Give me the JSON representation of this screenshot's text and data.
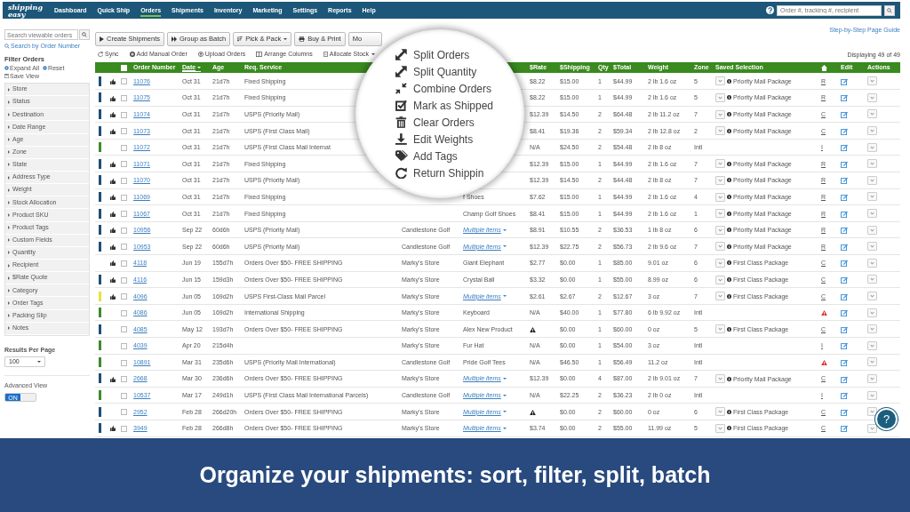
{
  "nav": {
    "logo": "shipping easy",
    "items": [
      {
        "label": "Dashboard",
        "selected": false
      },
      {
        "label": "Quick Ship",
        "selected": false
      },
      {
        "label": "Orders",
        "selected": true
      },
      {
        "label": "Shipments",
        "selected": false
      },
      {
        "label": "Inventory",
        "selected": false
      },
      {
        "label": "Marketing",
        "selected": false
      },
      {
        "label": "Settings",
        "selected": false
      },
      {
        "label": "Reports",
        "selected": false
      },
      {
        "label": "Help",
        "selected": false
      }
    ],
    "search": {
      "placeholder": "Order #, tracking #, recipient"
    }
  },
  "page_guide": "Step-by-Step Page Guide",
  "sidebar": {
    "search": {
      "placeholder": "Search viewable orders"
    },
    "search_link": "Search by Order Number",
    "filter_title": "Filter Orders",
    "filter_actions": [
      "Expand All",
      "Reset",
      "Save View"
    ],
    "filters": [
      "Store",
      "Status",
      "Destination",
      "Date Range",
      "Age",
      "Zone",
      "State",
      "Address Type",
      "Weight",
      "Stock Allocation",
      "Product SKU",
      "Product Tags",
      "Custom Fields",
      "Quantity",
      "Recipient",
      "$Rate Quote",
      "Category",
      "Order Tags",
      "Packing Slip",
      "Notes"
    ],
    "results_label": "Results Per Page",
    "results_value": "100",
    "advanced_label": "Advanced View",
    "advanced_toggle": {
      "label": "ON",
      "on": true
    }
  },
  "toolbar": {
    "buttons": [
      {
        "label": "Create Shipments",
        "dropdown": false
      },
      {
        "label": "Group as Batch",
        "dropdown": false
      },
      {
        "label": "Pick & Pack",
        "dropdown": true
      },
      {
        "label": "Buy & Print",
        "dropdown": false
      },
      {
        "label": "Mo",
        "dropdown": false
      }
    ],
    "actions": [
      {
        "label": "Sync",
        "dropdown": false
      },
      {
        "label": "Add Manual Order",
        "dropdown": false
      },
      {
        "label": "Upload Orders",
        "dropdown": false
      },
      {
        "label": "Arrange Columns",
        "dropdown": false
      },
      {
        "label": "Allocate Stock",
        "dropdown": true
      }
    ]
  },
  "displaying": "Displaying 49 of 49",
  "menu": {
    "items": [
      "Split Orders",
      "Split Quantity",
      "Combine Orders",
      "Mark as Shipped",
      "Clear Orders",
      "Edit Weights",
      "Add Tags",
      "Return Shippin"
    ]
  },
  "table": {
    "select_all": {
      "checked": false
    },
    "columns": [
      {
        "label": "Order Number",
        "sorted": false
      },
      {
        "label": "Date",
        "sorted": true
      },
      {
        "label": "Age",
        "sorted": false
      },
      {
        "label": "Req. Service",
        "sorted": false
      },
      {
        "label": "$Rate",
        "sorted": false
      },
      {
        "label": "$Shipping",
        "sorted": false
      },
      {
        "label": "Qty",
        "sorted": false
      },
      {
        "label": "$Total",
        "sorted": false
      },
      {
        "label": "Weight",
        "sorted": false
      },
      {
        "label": "Zone",
        "sorted": false
      },
      {
        "label": "Saved Selection",
        "sorted": false
      },
      {
        "label": "Edit",
        "sorted": false
      },
      {
        "label": "Actions",
        "sorted": false
      }
    ],
    "rows": [
      {
        "color": "#1d4e78",
        "marked": true,
        "checked": false,
        "order": "11076",
        "date": "Oct 31",
        "age": "21d7h",
        "service": "Fixed Shipping",
        "rate": "$8.22",
        "shipping": "$15.00",
        "qty": "1",
        "total": "$44.99",
        "weight": "2 lb 1.6 oz",
        "zone": "5",
        "selection": "Priority Mail Package",
        "home": "R"
      },
      {
        "color": "#1d4e78",
        "marked": true,
        "checked": false,
        "order": "11075",
        "date": "Oct 31",
        "age": "21d7h",
        "service": "Fixed Shipping",
        "rate": "$8.22",
        "shipping": "$15.00",
        "qty": "1",
        "total": "$44.99",
        "weight": "2 lb 1.6 oz",
        "zone": "5",
        "selection": "Priority Mail Package",
        "home": "R"
      },
      {
        "color": "#1d4e78",
        "marked": true,
        "checked": false,
        "order": "11074",
        "date": "Oct 31",
        "age": "21d7h",
        "service": "USPS (Priority Mail)",
        "rate": "$12.39",
        "shipping": "$14.50",
        "qty": "2",
        "total": "$64.48",
        "weight": "2 lb 11.2 oz",
        "zone": "7",
        "selection": "Priority Mail Package",
        "home": "C"
      },
      {
        "color": "#1d4e78",
        "marked": true,
        "checked": false,
        "order": "11073",
        "date": "Oct 31",
        "age": "21d7h",
        "service": "USPS (First Class Mail)",
        "rate": "$8.41",
        "shipping": "$19.36",
        "qty": "2",
        "total": "$59.34",
        "weight": "2 lb 12.8 oz",
        "zone": "2",
        "selection": "Priority Mail Package",
        "home": "C"
      },
      {
        "color": "#3f8a2c",
        "marked": false,
        "checked": false,
        "order": "11072",
        "date": "Oct 31",
        "age": "21d7h",
        "service": "USPS (First Class Mail Internat",
        "rate": "N/A",
        "shipping": "$24.50",
        "qty": "2",
        "total": "$54.48",
        "weight": "2 lb 8 oz",
        "zone": "Intl",
        "home": "I"
      },
      {
        "color": "#1d4e78",
        "marked": true,
        "checked": false,
        "order": "11071",
        "date": "Oct 31",
        "age": "21d7h",
        "service": "Fixed Shipping",
        "rate": "$12.39",
        "shipping": "$15.00",
        "qty": "1",
        "total": "$44.99",
        "weight": "2 lb 1.6 oz",
        "zone": "7",
        "selection": "Priority Mail Package",
        "home": "R"
      },
      {
        "color": "#1d4e78",
        "marked": true,
        "checked": false,
        "order": "11070",
        "date": "Oct 31",
        "age": "21d7h",
        "service": "USPS (Priority Mail)",
        "rate": "$12.39",
        "shipping": "$14.50",
        "qty": "2",
        "total": "$44.48",
        "weight": "2 lb 8 oz",
        "zone": "7",
        "selection": "Priority Mail Package",
        "home": "R"
      },
      {
        "color": "#1d4e78",
        "marked": true,
        "checked": false,
        "order": "11069",
        "date": "Oct 31",
        "age": "21d7h",
        "service": "Fixed Shipping",
        "item": "f Shoes",
        "item_dropdown": false,
        "rate": "$7.62",
        "shipping": "$15.00",
        "qty": "1",
        "total": "$44.99",
        "weight": "2 lb 1.6 oz",
        "zone": "4",
        "selection": "Priority Mail Package",
        "home": "R"
      },
      {
        "color": "#1d4e78",
        "marked": true,
        "checked": false,
        "order": "11067",
        "date": "Oct 31",
        "age": "21d7h",
        "service": "Fixed Shipping",
        "item": "Champ Golf Shoes",
        "item_dropdown": false,
        "rate": "$8.41",
        "shipping": "$15.00",
        "qty": "1",
        "total": "$44.99",
        "weight": "2 lb 1.6 oz",
        "zone": "1",
        "selection": "Priority Mail Package",
        "home": "R"
      },
      {
        "color": "#1d4e78",
        "marked": true,
        "checked": false,
        "order": "10956",
        "date": "Sep 22",
        "age": "60d6h",
        "service": "USPS (Priority Mail)",
        "store": "Candlestone Golf",
        "item": "Multiple items",
        "item_dropdown": true,
        "rate": "$8.91",
        "shipping": "$10.55",
        "qty": "2",
        "total": "$36.53",
        "weight": "1 lb 8 oz",
        "zone": "6",
        "selection": "Priority Mail Package",
        "home": "R"
      },
      {
        "color": "#1d4e78",
        "marked": true,
        "checked": false,
        "order": "10953",
        "date": "Sep 22",
        "age": "60d6h",
        "service": "USPS (Priority Mail)",
        "store": "Candlestone Golf",
        "item": "Multiple items",
        "item_dropdown": true,
        "rate": "$12.39",
        "shipping": "$22.75",
        "qty": "2",
        "total": "$56.73",
        "weight": "2 lb 9.6 oz",
        "zone": "7",
        "selection": "Priority Mail Package",
        "home": "R"
      },
      {
        "marked": true,
        "checked": false,
        "order": "4118",
        "date": "Jun 19",
        "age": "155d7h",
        "service": "Orders Over $50- FREE SHIPPING",
        "store": "Marky's Store",
        "item": "Giant Elephant",
        "item_dropdown": false,
        "rate": "$2.77",
        "shipping": "$0.00",
        "qty": "1",
        "total": "$85.00",
        "weight": "9.01 oz",
        "zone": "6",
        "selection": "First Class Package",
        "home": "C"
      },
      {
        "color": "#1d4e78",
        "marked": true,
        "checked": false,
        "order": "4116",
        "date": "Jun 15",
        "age": "159d3h",
        "service": "Orders Over $50- FREE SHIPPING",
        "store": "Marky's Store",
        "item": "Crystal Ball",
        "item_dropdown": false,
        "rate": "$3.32",
        "shipping": "$0.00",
        "qty": "1",
        "total": "$55.00",
        "weight": "8.99 oz",
        "zone": "6",
        "selection": "First Class Package",
        "home": "C"
      },
      {
        "color": "#e9e23c",
        "marked": true,
        "checked": false,
        "order": "4096",
        "date": "Jun 05",
        "age": "169d2h",
        "service": "USPS First-Class Mail Parcel",
        "store": "Marky's Store",
        "item": "Multiple items",
        "item_dropdown": true,
        "rate": "$2.61",
        "shipping": "$2.67",
        "qty": "2",
        "total": "$12.67",
        "weight": "3 oz",
        "zone": "7",
        "selection": "First Class Package",
        "home": "C"
      },
      {
        "color": "#3f8a2c",
        "marked": false,
        "checked": false,
        "order": "4086",
        "date": "Jun 05",
        "age": "169d2h",
        "service": "International Shipping",
        "store": "Marky's Store",
        "item": "Keyboard",
        "item_dropdown": false,
        "rate": "N/A",
        "shipping": "$40.00",
        "qty": "1",
        "total": "$77.80",
        "weight": "6 lb 9.92 oz",
        "zone": "Intl",
        "home_alert": true
      },
      {
        "color": "#1d4e78",
        "marked": false,
        "checked": false,
        "order": "4085",
        "date": "May 12",
        "age": "193d7h",
        "service": "Orders Over $50- FREE SHIPPING",
        "store": "Marky's Store",
        "item": "Alex New Product",
        "item_dropdown": false,
        "rate_alert": true,
        "shipping": "$0.00",
        "qty": "1",
        "total": "$60.00",
        "weight": "0 oz",
        "zone": "5",
        "selection": "First Class Package",
        "home": "C"
      },
      {
        "color": "#3f8a2c",
        "marked": false,
        "checked": false,
        "order": "4039",
        "date": "Apr 20",
        "age": "215d4h",
        "store": "Marky's Store",
        "item": "Fur Hat",
        "item_dropdown": false,
        "rate": "N/A",
        "shipping": "$0.00",
        "qty": "1",
        "total": "$54.00",
        "weight": "3 oz",
        "zone": "Intl",
        "home": "I"
      },
      {
        "color": "#3f8a2c",
        "marked": false,
        "checked": false,
        "order": "10891",
        "date": "Mar 31",
        "age": "235d6h",
        "service": "USPS (Priority Mail International)",
        "store": "Candlestone Golf",
        "item": "Pride Golf Tees",
        "item_dropdown": false,
        "rate": "N/A",
        "shipping": "$46.50",
        "qty": "1",
        "total": "$56.49",
        "weight": "11.2 oz",
        "zone": "Intl",
        "home_alert": true
      },
      {
        "color": "#1d4e78",
        "marked": true,
        "checked": false,
        "order": "2668",
        "date": "Mar 30",
        "age": "236d6h",
        "service": "Orders Over $50- FREE SHIPPING",
        "store": "Marky's Store",
        "item": "Multiple items",
        "item_dropdown": true,
        "rate": "$12.39",
        "shipping": "$0.00",
        "qty": "4",
        "total": "$87.00",
        "weight": "2 lb 9.01 oz",
        "zone": "7",
        "selection": "Priority Mail Package",
        "home": "C"
      },
      {
        "color": "#3f8a2c",
        "marked": false,
        "checked": false,
        "order": "10537",
        "date": "Mar 17",
        "age": "249d1h",
        "service": "USPS (First Class Mail International Parcels)",
        "store": "Candlestone Golf",
        "item": "Multiple items",
        "item_dropdown": true,
        "rate": "N/A",
        "shipping": "$22.25",
        "qty": "2",
        "total": "$36.23",
        "weight": "2 lb 0 oz",
        "zone": "Intl",
        "home": "I"
      },
      {
        "color": "#1d4e78",
        "marked": false,
        "checked": false,
        "order": "2952",
        "date": "Feb 28",
        "age": "266d20h",
        "service": "Orders Over $50- FREE SHIPPING",
        "store": "Marky's Store",
        "item": "Multiple items",
        "item_dropdown": true,
        "rate_alert": true,
        "shipping": "$0.00",
        "qty": "2",
        "total": "$60.00",
        "weight": "0 oz",
        "zone": "6",
        "selection": "First Class Package",
        "home": "C"
      },
      {
        "color": "#1d4e78",
        "marked": true,
        "checked": false,
        "order": "3949",
        "date": "Feb 28",
        "age": "266d8h",
        "service": "Orders Over $50- FREE SHIPPING",
        "store": "Marky's Store",
        "item": "Multiple items",
        "item_dropdown": true,
        "rate": "$3.74",
        "shipping": "$0.00",
        "qty": "2",
        "total": "$55.00",
        "weight": "11.99 oz",
        "zone": "5",
        "selection": "First Class Package",
        "home": "C"
      }
    ]
  },
  "help_button": "?",
  "caption": "Organize your shipments: sort, filter, split, batch"
}
